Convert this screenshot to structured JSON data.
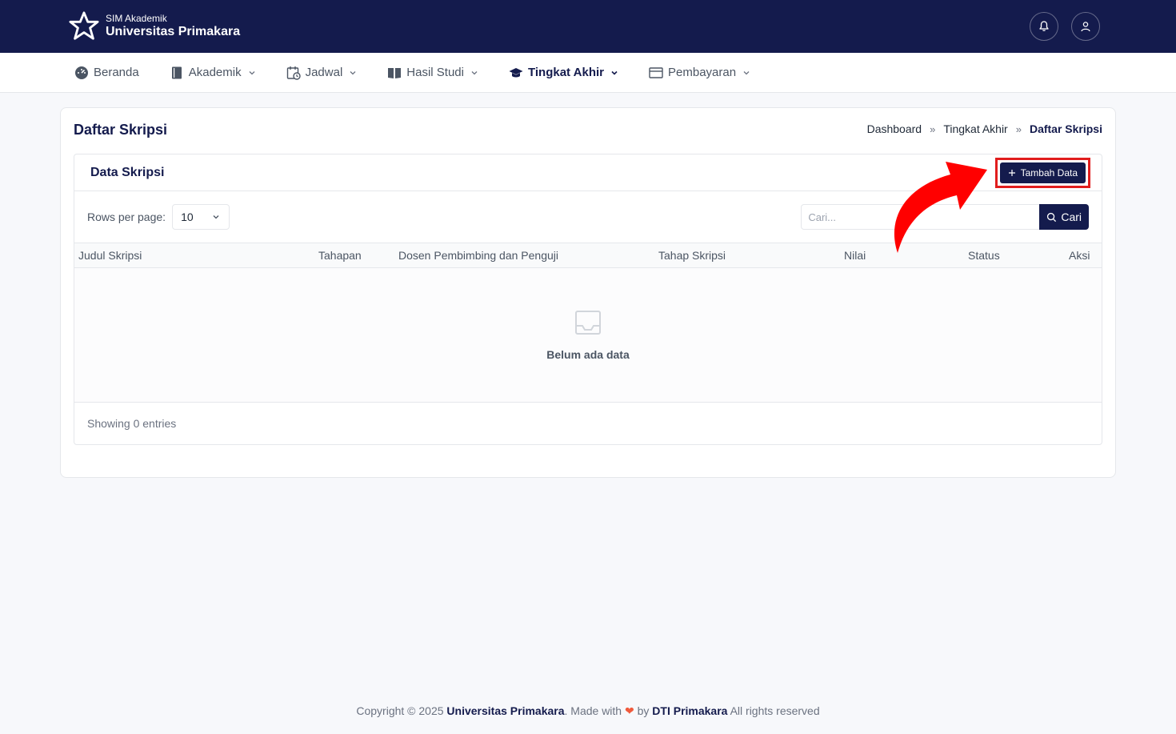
{
  "header": {
    "app_subtitle": "SIM Akademik",
    "app_title": "Universitas Primakara",
    "icons": [
      "bell-icon",
      "user-icon"
    ]
  },
  "nav": {
    "items": [
      {
        "label": "Beranda",
        "icon": "dashboard-icon"
      },
      {
        "label": "Akademik",
        "icon": "book-icon"
      },
      {
        "label": "Jadwal",
        "icon": "calendar-clock-icon"
      },
      {
        "label": "Hasil Studi",
        "icon": "open-book-icon"
      },
      {
        "label": "Tingkat Akhir",
        "icon": "graduation-cap-icon",
        "active": true
      },
      {
        "label": "Pembayaran",
        "icon": "card-icon"
      }
    ]
  },
  "page": {
    "title": "Daftar Skripsi",
    "breadcrumb": [
      "Dashboard",
      "Tingkat Akhir",
      "Daftar Skripsi"
    ],
    "breadcrumb_sep": "»"
  },
  "panel": {
    "title": "Data Skripsi",
    "add_button": "Tambah Data",
    "rows_label": "Rows per page:",
    "rows_value": "10",
    "search_placeholder": "Cari...",
    "search_button": "Cari"
  },
  "table": {
    "columns": [
      "Judul Skripsi",
      "Tahapan",
      "Dosen Pembimbing dan Penguji",
      "Tahap Skripsi",
      "Nilai",
      "Status",
      "Aksi"
    ],
    "rows": [],
    "empty_text": "Belum ada data",
    "footer": "Showing 0 entries"
  },
  "footer": {
    "prefix": "Copyright © 2025 ",
    "org": "Universitas Primakara",
    "made_with": ". Made with ",
    "heart": "❤",
    "by": " by ",
    "team": "DTI Primakara",
    "suffix": " All rights reserved"
  },
  "colors": {
    "primary": "#141b4d",
    "highlight": "#e11d1d",
    "accent_arrow": "#ff0000"
  }
}
